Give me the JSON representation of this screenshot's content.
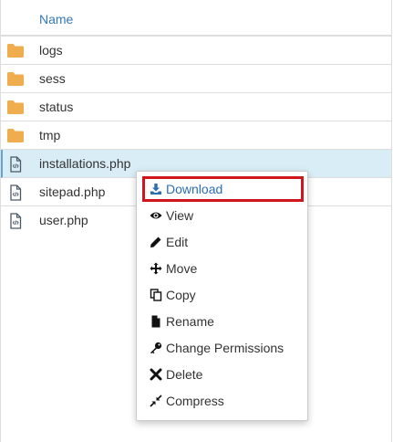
{
  "file_list": {
    "header": {
      "name_label": "Name"
    },
    "rows": [
      {
        "name": "logs",
        "type": "folder"
      },
      {
        "name": "sess",
        "type": "folder"
      },
      {
        "name": "status",
        "type": "folder"
      },
      {
        "name": "tmp",
        "type": "folder"
      },
      {
        "name": "installations.php",
        "type": "file",
        "selected": true
      },
      {
        "name": "sitepad.php",
        "type": "file"
      },
      {
        "name": "user.php",
        "type": "file"
      }
    ]
  },
  "context_menu": {
    "items": [
      {
        "label": "Download",
        "icon": "download-icon",
        "highlighted": true
      },
      {
        "label": "View",
        "icon": "eye-icon"
      },
      {
        "label": "Edit",
        "icon": "pencil-icon"
      },
      {
        "label": "Move",
        "icon": "move-arrows-icon"
      },
      {
        "label": "Copy",
        "icon": "copy-icon"
      },
      {
        "label": "Rename",
        "icon": "file-icon"
      },
      {
        "label": "Change Permissions",
        "icon": "key-icon"
      },
      {
        "label": "Delete",
        "icon": "x-icon"
      },
      {
        "label": "Compress",
        "icon": "compress-icon"
      }
    ]
  },
  "colors": {
    "accent_link": "#337ab7",
    "selected_row": "#d9edf7",
    "folder": "#f0ad4e",
    "highlight_border": "#d0161d"
  }
}
